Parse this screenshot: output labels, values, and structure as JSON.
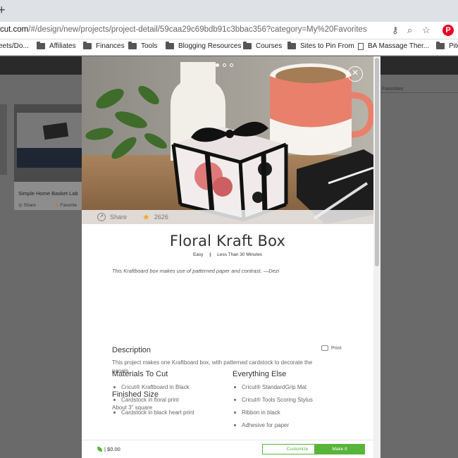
{
  "browser": {
    "new_tab_symbol": "+",
    "url_host": "cut.com",
    "url_rest": "/#/design/new/projects/project-detail/59caa29c69bdb91c3bbac356?category=My%20Favorites",
    "icons": [
      "key-icon",
      "zoom-icon",
      "star-icon",
      "pinterest-icon"
    ],
    "pinterest_label": "P",
    "bookmarks": [
      {
        "label": "eets/Do...",
        "icon": "page-icon"
      },
      {
        "label": "Affiliates",
        "icon": "folder-icon"
      },
      {
        "label": "Finances",
        "icon": "folder-icon"
      },
      {
        "label": "Tools",
        "icon": "folder-icon"
      },
      {
        "label": "Blogging Resources",
        "icon": "folder-icon"
      },
      {
        "label": "Courses",
        "icon": "folder-icon"
      },
      {
        "label": "Sites to Pin From",
        "icon": "folder-icon"
      },
      {
        "label": "BA Massage Ther...",
        "icon": "page-icon"
      },
      {
        "label": "Pitc",
        "icon": "folder-icon"
      }
    ]
  },
  "background": {
    "card_title": "Simple Home Basket Lab",
    "card_share": "Share",
    "card_favorite": "Favorite",
    "card_tag": "",
    "right_label": "y Favorites"
  },
  "modal": {
    "close_symbol": "×",
    "share_label": "Share",
    "favorite_count": "2626",
    "title": "Floral Kraft Box",
    "difficulty": "Easy",
    "time": "Less Than 30 Minutes",
    "tagline": "This Kraftboard box makes use of patterned paper and contrast. —Dezi",
    "description_heading": "Description",
    "print_label": "Print",
    "description_text": "This project makes one Kraftboard box, with patterned cardstock to decorate the panels.",
    "finished_size_heading": "Finished Size",
    "finished_size_text": "About 3\" square",
    "materials_heading": "Materials To Cut",
    "materials": [
      "Cricut® Kraftboard in Black",
      "Cardstock in floral print",
      "Cardstock in black heart print"
    ],
    "everything_else_heading": "Everything Else",
    "everything_else": [
      "Cricut® StandardGrip Mat",
      "Cricut® Tools Scoring Stylus",
      "Ribbon in black",
      "Adhesive for paper"
    ],
    "price": "| $0.00",
    "customize_label": "Customize",
    "make_it_label": "Make It"
  },
  "colors": {
    "accent_green": "#59b43a",
    "favorite_star": "#f5a623",
    "pinterest_red": "#e60023"
  }
}
